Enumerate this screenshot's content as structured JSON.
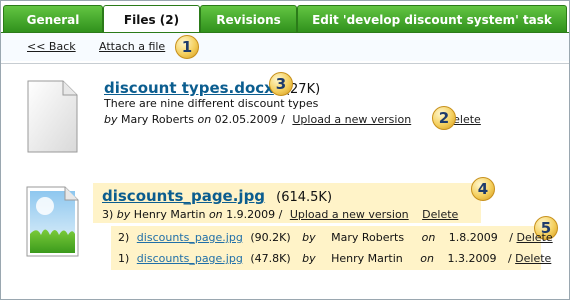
{
  "tabs": [
    "General",
    "Files (2)",
    "Revisions",
    "Edit 'develop discount system' task"
  ],
  "active_tab_index": 1,
  "toolbar": {
    "back": "<< Back",
    "attach": "Attach a file"
  },
  "badges": [
    "1",
    "2",
    "3",
    "4",
    "5"
  ],
  "file1": {
    "name": "discount types.docx",
    "size": "(27K)",
    "description": "There are nine different discount types",
    "by_label": "by",
    "author": "Mary Roberts",
    "on_label": "on",
    "date": "02.05.2009",
    "sep": "/",
    "upload": "Upload a new version",
    "delete": "Delete"
  },
  "file2": {
    "name": "discounts_page.jpg",
    "size": "(614.5K)",
    "version_no": "3)",
    "by_label": "by",
    "author": "Henry Martin",
    "on_label": "on",
    "date": "1.9.2009",
    "sep": "/",
    "upload": "Upload a new version",
    "delete": "Delete",
    "versions": [
      {
        "no": "2)",
        "name": "discounts_page.jpg",
        "size": "(90.2K)",
        "by": "by",
        "author": "Mary Roberts",
        "on": "on",
        "date": "1.8.2009",
        "sep": "/",
        "delete": "Delete"
      },
      {
        "no": "1)",
        "name": "discounts_page.jpg",
        "size": "(47.8K)",
        "by": "by",
        "author": "Henry Martin",
        "on": "on",
        "date": "1.3.2009",
        "sep": "/",
        "delete": "Delete"
      }
    ]
  },
  "colors": {
    "tab_green": "#3ea524",
    "link_blue": "#0b5d8f",
    "highlight": "#fff3c8",
    "badge": "#f4cf5e"
  }
}
